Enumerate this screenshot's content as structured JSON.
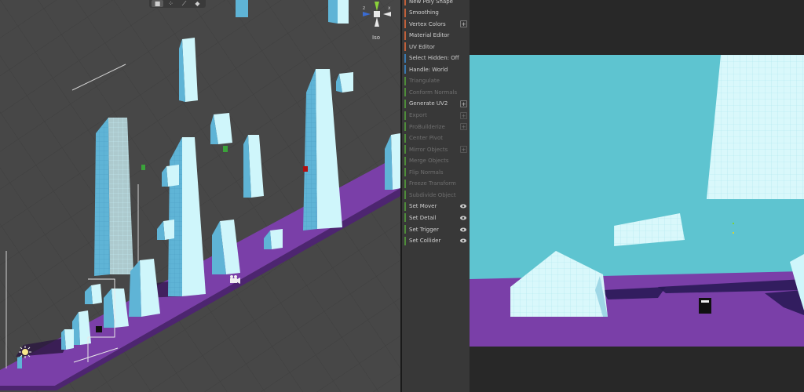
{
  "scene": {
    "iso_label": "Iso",
    "axis_labels": {
      "z": "z",
      "x": "x"
    },
    "toolbar_icons": [
      "cube-icon",
      "vertex-icon",
      "edge-icon",
      "face-icon"
    ]
  },
  "toolbar": {
    "items": [
      {
        "label": "New Poly Shape",
        "color": "#c0603a",
        "disabled": false,
        "suffix": "none"
      },
      {
        "label": "Smoothing",
        "color": "#c0603a",
        "disabled": false,
        "suffix": "none"
      },
      {
        "label": "Vertex Colors",
        "color": "#c0603a",
        "disabled": false,
        "suffix": "plus"
      },
      {
        "label": "Material Editor",
        "color": "#c0603a",
        "disabled": false,
        "suffix": "none"
      },
      {
        "label": "UV Editor",
        "color": "#c0603a",
        "disabled": false,
        "suffix": "none"
      },
      {
        "label": "Select Hidden: Off",
        "color": "#3a7ab0",
        "disabled": false,
        "suffix": "none"
      },
      {
        "label": "Handle: World",
        "color": "#3a7ab0",
        "disabled": false,
        "suffix": "none"
      },
      {
        "label": "Triangulate",
        "color": "#4e8c3a",
        "disabled": true,
        "suffix": "none"
      },
      {
        "label": "Conform Normals",
        "color": "#4e8c3a",
        "disabled": true,
        "suffix": "none"
      },
      {
        "label": "Generate UV2",
        "color": "#4e8c3a",
        "disabled": false,
        "suffix": "plus"
      },
      {
        "label": "Export",
        "color": "#4e8c3a",
        "disabled": true,
        "suffix": "plus"
      },
      {
        "label": "ProBuilderize",
        "color": "#4e8c3a",
        "disabled": true,
        "suffix": "plus"
      },
      {
        "label": "Center Pivot",
        "color": "#4e8c3a",
        "disabled": true,
        "suffix": "none"
      },
      {
        "label": "Mirror Objects",
        "color": "#4e8c3a",
        "disabled": true,
        "suffix": "plus"
      },
      {
        "label": "Merge Objects",
        "color": "#4e8c3a",
        "disabled": true,
        "suffix": "none"
      },
      {
        "label": "Flip Normals",
        "color": "#4e8c3a",
        "disabled": true,
        "suffix": "none"
      },
      {
        "label": "Freeze Transform",
        "color": "#4e8c3a",
        "disabled": true,
        "suffix": "none"
      },
      {
        "label": "Subdivide Object",
        "color": "#4e8c3a",
        "disabled": true,
        "suffix": "none"
      },
      {
        "label": "Set Mover",
        "color": "#4e8c3a",
        "disabled": false,
        "suffix": "eye"
      },
      {
        "label": "Set Detail",
        "color": "#4e8c3a",
        "disabled": false,
        "suffix": "eye"
      },
      {
        "label": "Set Trigger",
        "color": "#4e8c3a",
        "disabled": false,
        "suffix": "eye"
      },
      {
        "label": "Set Collider",
        "color": "#4e8c3a",
        "disabled": false,
        "suffix": "eye"
      }
    ]
  },
  "colors": {
    "scene_bg": "#474747",
    "ground": "#7a3fa8",
    "ice": "#cff6fb",
    "ice_side": "#5fb4d6",
    "sky": "#5ec4d0",
    "panel_bg": "#383838"
  }
}
